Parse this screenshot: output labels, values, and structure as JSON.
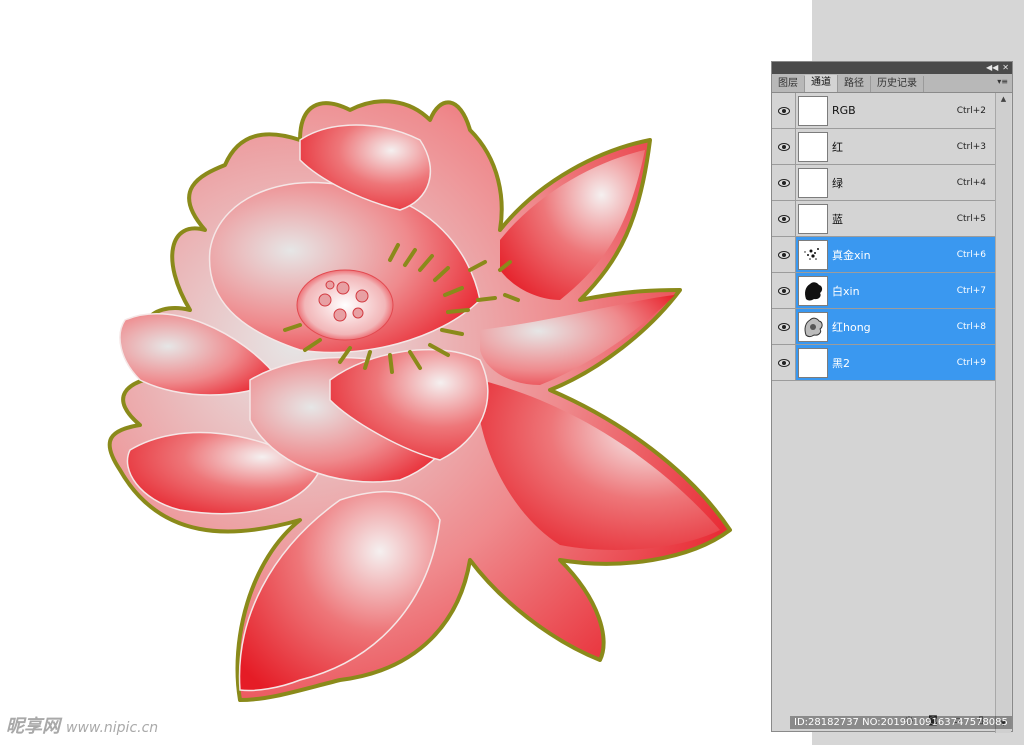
{
  "panel": {
    "tabs": [
      {
        "label": "图层",
        "active": false
      },
      {
        "label": "通道",
        "active": true
      },
      {
        "label": "路径",
        "active": false
      },
      {
        "label": "历史记录",
        "active": false
      }
    ],
    "collapse_icon": "double-chevron-left-icon",
    "close_icon": "close-icon",
    "menu_icon": "panel-menu-icon",
    "channels": [
      {
        "name": "RGB",
        "shortcut": "Ctrl+2",
        "selected": false,
        "thumb": "blank"
      },
      {
        "name": "红",
        "shortcut": "Ctrl+3",
        "selected": false,
        "thumb": "blank"
      },
      {
        "name": "绿",
        "shortcut": "Ctrl+4",
        "selected": false,
        "thumb": "blank"
      },
      {
        "name": "蓝",
        "shortcut": "Ctrl+5",
        "selected": false,
        "thumb": "blank"
      },
      {
        "name": "真金xin",
        "shortcut": "Ctrl+6",
        "selected": true,
        "thumb": "dots"
      },
      {
        "name": "白xin",
        "shortcut": "Ctrl+7",
        "selected": true,
        "thumb": "flower-dark"
      },
      {
        "name": "红hong",
        "shortcut": "Ctrl+8",
        "selected": true,
        "thumb": "flower-light"
      },
      {
        "name": "黑2",
        "shortcut": "Ctrl+9",
        "selected": true,
        "thumb": "blank"
      }
    ]
  },
  "watermark": {
    "logo": "昵享网",
    "url": "www.nipic.cn",
    "id_text": "ID:28182737 NO:20190109163747578085"
  },
  "colors": {
    "selected_row": "#3a98f0",
    "petal_red": "#e8202a",
    "outline_olive": "#8a8a1a"
  }
}
